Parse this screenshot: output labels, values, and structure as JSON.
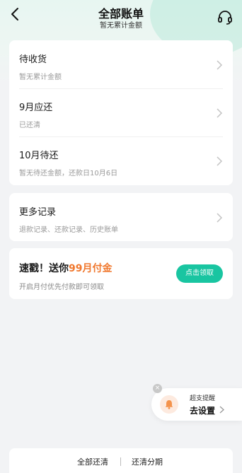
{
  "header": {
    "title": "全部账单",
    "subtitle": "暂无累计金额",
    "back_icon": "chevron-left-icon",
    "support_icon": "headset-icon"
  },
  "bill_list": [
    {
      "title": "待收货",
      "subtitle": "暂无累计金额"
    },
    {
      "title": "9月应还",
      "subtitle": "已还清"
    },
    {
      "title": "10月待还",
      "subtitle": "暂无待还金额，还款日10月6日"
    }
  ],
  "more_records": {
    "title": "更多记录",
    "subtitle": "退款记录、还款记录、历史账单"
  },
  "promo": {
    "title_prefix": "速戳！送你",
    "title_highlight": "99月付金",
    "subtitle": "开启月付优先付款即可领取",
    "button_label": "点击领取",
    "accent_color": "#19c5a1",
    "highlight_color": "#f0782e"
  },
  "reminder": {
    "label": "超支提醒",
    "action": "去设置",
    "icon": "bell-icon"
  },
  "bottom_bar": {
    "left_label": "全部还清",
    "right_label": "还清分期"
  }
}
